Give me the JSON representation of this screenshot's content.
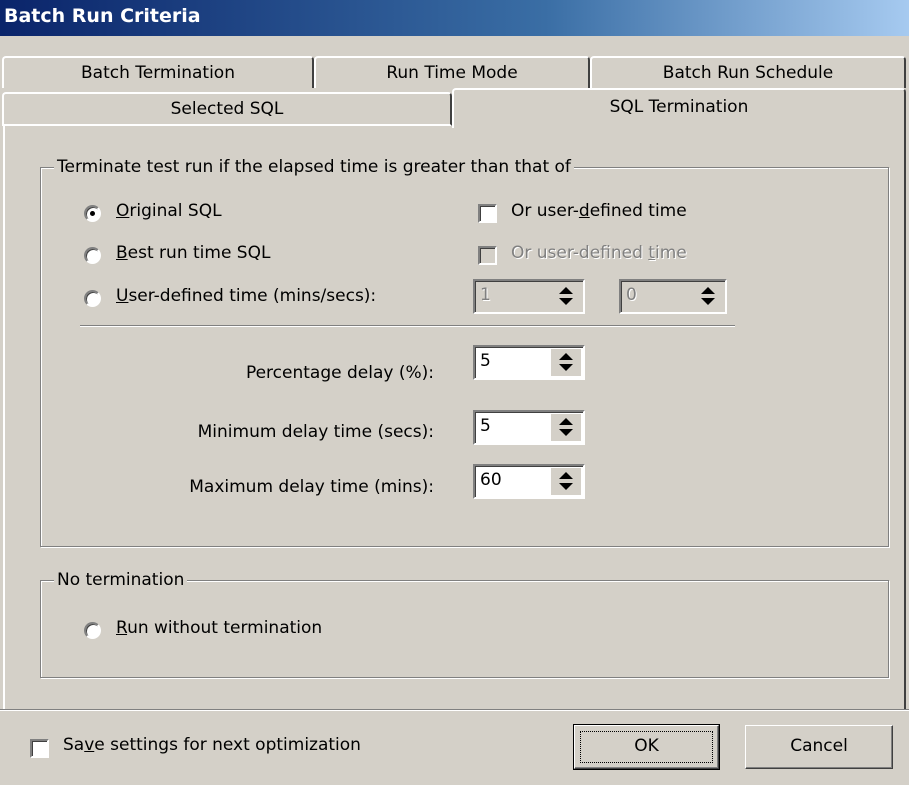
{
  "window": {
    "title": "Batch Run Criteria"
  },
  "tabs": {
    "row_back": [
      "Batch Termination",
      "Run Time Mode",
      "Batch Run Schedule"
    ],
    "row_front": [
      "Selected SQL",
      "SQL Termination"
    ],
    "active": "SQL Termination"
  },
  "terminate_group": {
    "legend": "Terminate test run if the elapsed time is greater than that of",
    "options": [
      {
        "mnemonic": "O",
        "rest": "riginal SQL",
        "checked": true
      },
      {
        "mnemonic": "B",
        "rest": "est run time SQL",
        "checked": false
      },
      {
        "mnemonic": "U",
        "rest": "ser-defined time (mins/secs):",
        "checked": false
      }
    ],
    "user_time_check_1": {
      "pre": "Or user-",
      "mnemonic": "d",
      "post": "efined time",
      "checked": false,
      "enabled": true
    },
    "user_time_check_2": {
      "pre": "Or user-defined ",
      "mnemonic": "t",
      "post": "ime",
      "checked": false,
      "enabled": false
    },
    "mins_value": "1",
    "secs_value": "0",
    "percentage_delay": {
      "label": "Percentage delay (%):",
      "value": "5"
    },
    "min_delay": {
      "label": "Minimum delay time (secs):",
      "value": "5"
    },
    "max_delay": {
      "label": "Maximum delay time (mins):",
      "value": "60"
    }
  },
  "no_termination_group": {
    "legend": "No termination",
    "option": {
      "mnemonic": "R",
      "rest": "un without termination",
      "checked": false
    }
  },
  "footer": {
    "save_check": {
      "pre": "Sa",
      "mnemonic": "v",
      "post": "e settings for next optimization",
      "checked": false
    },
    "ok_label": "OK",
    "cancel_label": "Cancel"
  }
}
